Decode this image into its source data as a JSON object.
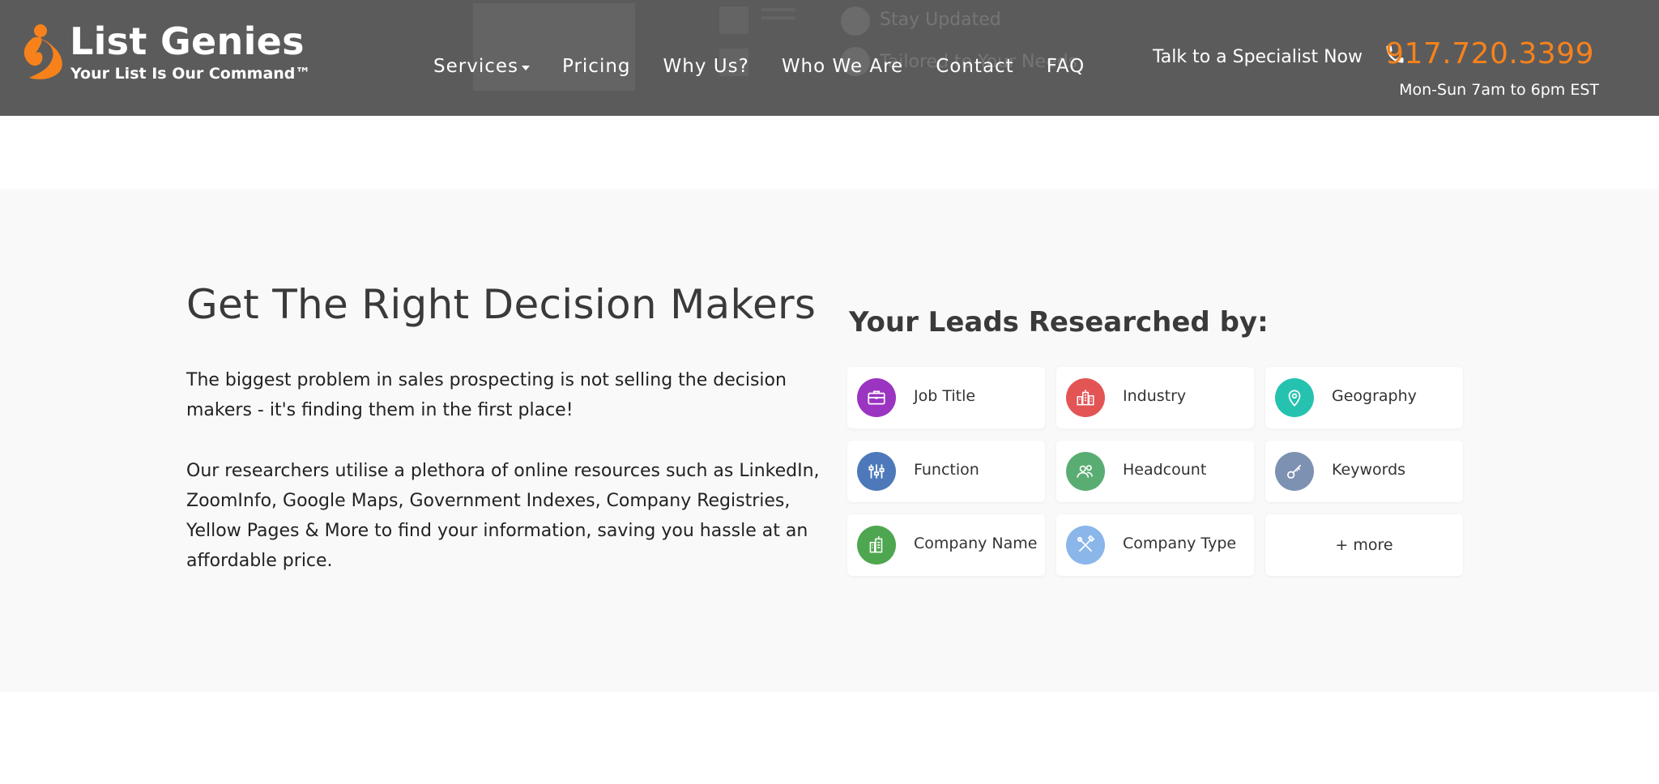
{
  "header": {
    "logo_title": "List Genies",
    "logo_tagline": "Your List Is Our Command™",
    "nav": [
      {
        "label": "Services",
        "has_dropdown": true
      },
      {
        "label": "Pricing"
      },
      {
        "label": "Why Us?"
      },
      {
        "label": "Who We Are"
      },
      {
        "label": "Contact"
      },
      {
        "label": "FAQ"
      }
    ],
    "cta_label": "Talk to a Specialist Now",
    "phone": "917.720.3399",
    "hours": "Mon-Sun 7am to 6pm EST",
    "background_ghost_text": [
      "Stay Updated",
      "Tailored to Your Needs"
    ]
  },
  "main": {
    "headline": "Get The Right Decision Makers",
    "paragraph1": "The biggest problem in sales prospecting is not selling the decision makers - it's finding them in the first place!",
    "paragraph2": "Our researchers utilise a plethora of online resources such as LinkedIn, ZoomInfo, Google Maps, Government Indexes, Company Registries, Yellow Pages & More to find your information, saving you hassle at an affordable price."
  },
  "leads": {
    "title": "Your Leads Researched by:",
    "items": [
      {
        "label": "Job Title",
        "icon": "briefcase-icon",
        "color": "#9b34c1"
      },
      {
        "label": "Industry",
        "icon": "city-buildings-icon",
        "color": "#e35454"
      },
      {
        "label": "Geography",
        "icon": "map-pin-icon",
        "color": "#26c2b0"
      },
      {
        "label": "Function",
        "icon": "sliders-icon",
        "color": "#4d79ba"
      },
      {
        "label": "Headcount",
        "icon": "people-icon",
        "color": "#5aad72"
      },
      {
        "label": "Keywords",
        "icon": "key-icon",
        "color": "#7d91b2"
      },
      {
        "label": "Company Name",
        "icon": "building-icon",
        "color": "#4fa650"
      },
      {
        "label": "Company Type",
        "icon": "tools-icon",
        "color": "#8ab6ea"
      },
      {
        "label": "+ more"
      }
    ]
  },
  "colors": {
    "header_bg": "#5b5b5b",
    "accent_orange": "#f7821b",
    "section_bg": "#f9f9f9"
  }
}
